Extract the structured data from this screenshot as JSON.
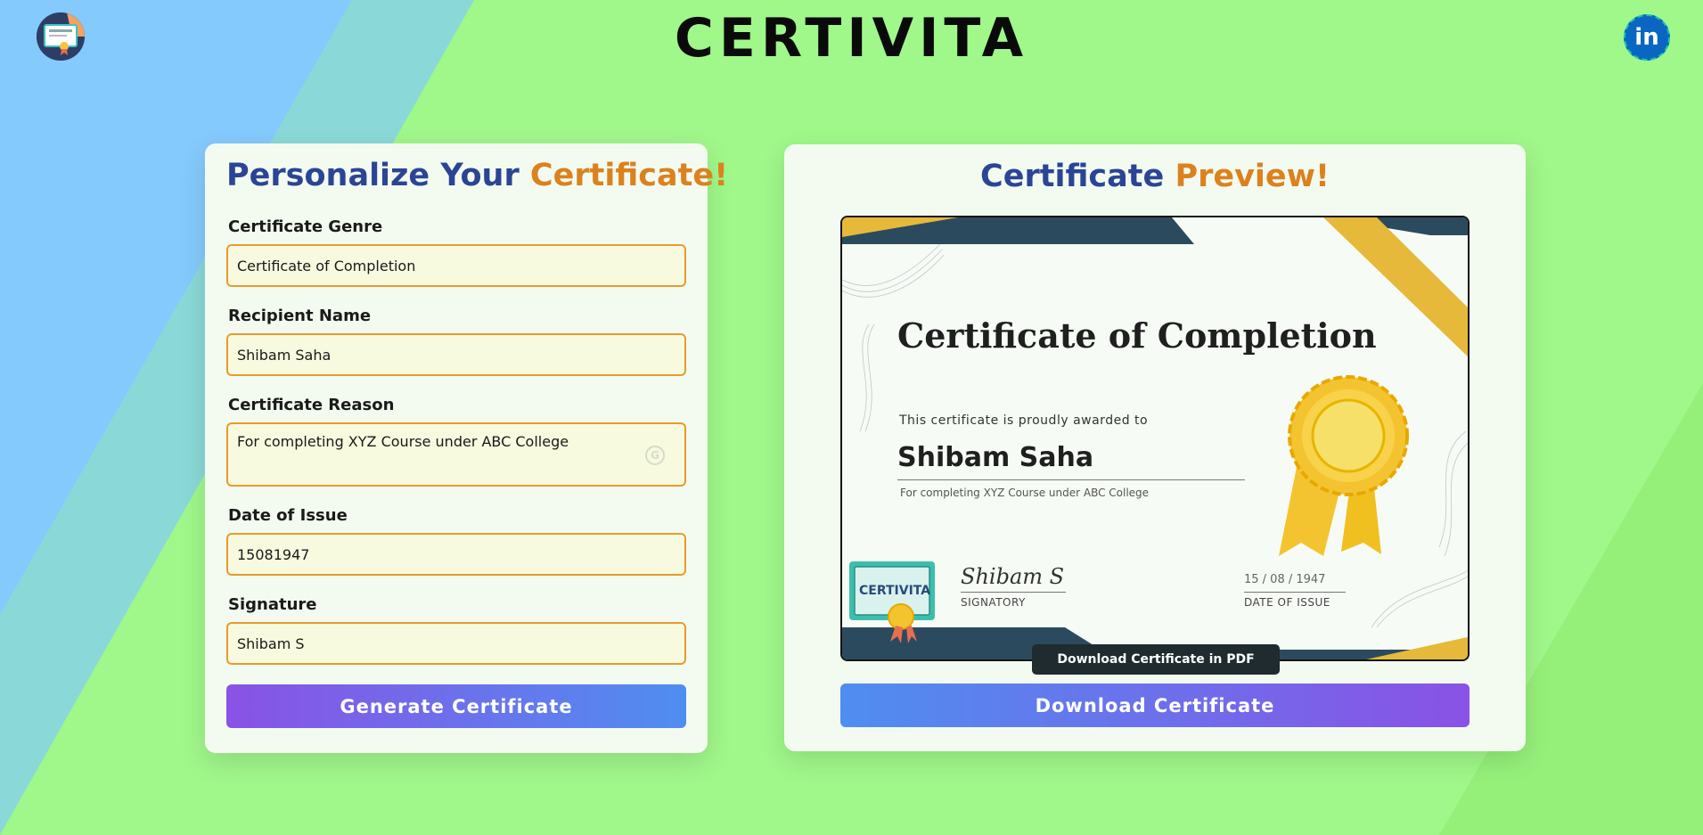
{
  "app": {
    "title": "CERTIVITA",
    "linkedin_glyph": "in",
    "colors": {
      "accent_blue": "#2b4594",
      "accent_orange": "#db821e",
      "background": "#a0f78a"
    }
  },
  "form": {
    "title_part1": "Personalize Your",
    "title_part2": "Certificate!",
    "fields": [
      {
        "label": "Certificate Genre",
        "value": "Certificate of Completion"
      },
      {
        "label": "Recipient Name",
        "value": "Shibam Saha"
      },
      {
        "label": "Certificate Reason",
        "value": "For completing XYZ Course under ABC College"
      },
      {
        "label": "Date of Issue",
        "value": "15081947"
      },
      {
        "label": "Signature",
        "value": "Shibam S"
      }
    ],
    "generate_label": "Generate Certificate"
  },
  "preview": {
    "title_part1": "Certificate",
    "title_part2": "Preview!",
    "tooltip": "Download Certificate in PDF Format!",
    "download_label": "Download Certificate",
    "certificate": {
      "title": "Certificate of Completion",
      "awarded_text": "This certificate is proudly awarded to",
      "recipient": "Shibam Saha",
      "reason": "For completing XYZ Course under ABC College",
      "signature": "Shibam S",
      "signature_label": "SIGNATORY",
      "date": "15 / 08 / 1947",
      "date_label": "DATE OF ISSUE",
      "stamp_text": "CERTIVITA"
    }
  }
}
